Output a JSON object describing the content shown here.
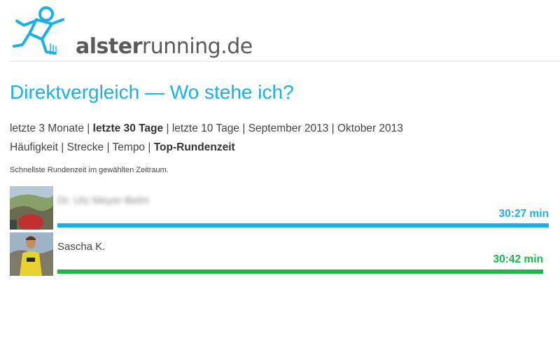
{
  "brand": {
    "part1": "alster",
    "part2": "running",
    "part3": ".de"
  },
  "title": "Direktvergleich — Wo stehe ich?",
  "period_filters": [
    {
      "label": "letzte 3 Monate",
      "active": false
    },
    {
      "label": "letzte 30 Tage",
      "active": true
    },
    {
      "label": "letzte 10 Tage",
      "active": false
    },
    {
      "label": "September 2013",
      "active": false
    },
    {
      "label": "Oktober 2013",
      "active": false
    }
  ],
  "metric_filters": [
    {
      "label": "Häufigkeit",
      "active": false
    },
    {
      "label": "Strecke",
      "active": false
    },
    {
      "label": "Tempo",
      "active": false
    },
    {
      "label": "Top-Rundenzeit",
      "active": true
    }
  ],
  "separator": "|",
  "description": "Schnellste Rundenzeit im gewählten Zeitraum.",
  "entries": [
    {
      "name": "Dr. Utz Meyer-Belm",
      "time": "30:27 min",
      "color": "#1ab0e6",
      "blurred": true
    },
    {
      "name": "Sascha K.",
      "time": "30:42 min",
      "color": "#1cb848",
      "blurred": false
    }
  ]
}
